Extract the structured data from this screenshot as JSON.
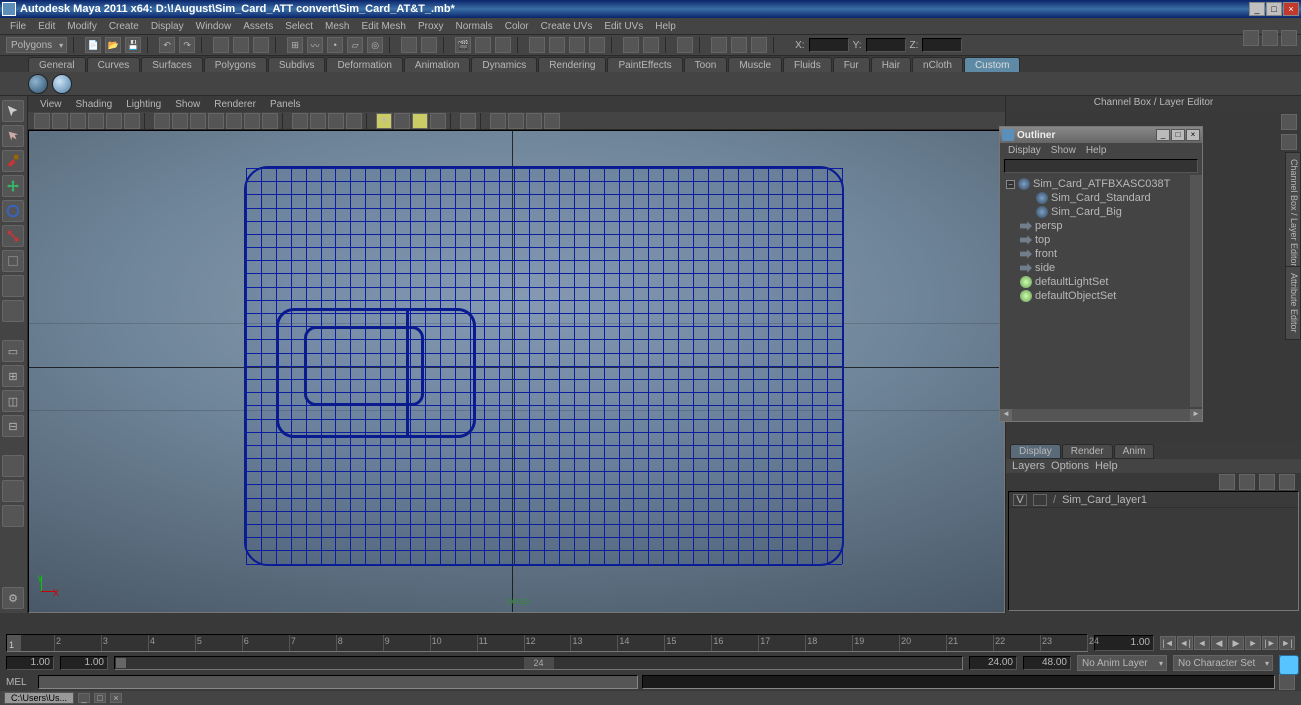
{
  "window": {
    "title": "Autodesk Maya 2011 x64: D:\\!August\\Sim_Card_ATT convert\\Sim_Card_AT&T_.mb*",
    "min": "_",
    "max": "□",
    "close": "×"
  },
  "menus": [
    "File",
    "Edit",
    "Modify",
    "Create",
    "Display",
    "Window",
    "Assets",
    "Select",
    "Mesh",
    "Edit Mesh",
    "Proxy",
    "Normals",
    "Color",
    "Create UVs",
    "Edit UVs",
    "Help"
  ],
  "module_dropdown": "Polygons",
  "coord": {
    "x": "X:",
    "y": "Y:",
    "z": "Z:"
  },
  "shelves": [
    "General",
    "Curves",
    "Surfaces",
    "Polygons",
    "Subdivs",
    "Deformation",
    "Animation",
    "Dynamics",
    "Rendering",
    "PaintEffects",
    "Toon",
    "Muscle",
    "Fluids",
    "Fur",
    "Hair",
    "nCloth",
    "Custom"
  ],
  "active_shelf": "Custom",
  "panel_menus": [
    "View",
    "Shading",
    "Lighting",
    "Show",
    "Renderer",
    "Panels"
  ],
  "viewport": {
    "camera": "persp",
    "axis_y": "Y",
    "axis_x": "X"
  },
  "channelbox_title": "Channel Box / Layer Editor",
  "outliner": {
    "title": "Outliner",
    "menus": [
      "Display",
      "Show",
      "Help"
    ],
    "items": [
      {
        "name": "Sim_Card_ATFBXASC038T",
        "type": "mesh",
        "indent": 0,
        "expanded": true
      },
      {
        "name": "Sim_Card_Standard",
        "type": "mesh",
        "indent": 1
      },
      {
        "name": "Sim_Card_Big",
        "type": "mesh",
        "indent": 1
      },
      {
        "name": "persp",
        "type": "cam",
        "indent": 0,
        "dim": true
      },
      {
        "name": "top",
        "type": "cam",
        "indent": 0,
        "dim": true
      },
      {
        "name": "front",
        "type": "cam",
        "indent": 0,
        "dim": true
      },
      {
        "name": "side",
        "type": "cam",
        "indent": 0,
        "dim": true
      },
      {
        "name": "defaultLightSet",
        "type": "set",
        "indent": 0
      },
      {
        "name": "defaultObjectSet",
        "type": "set",
        "indent": 0
      }
    ]
  },
  "layers_tabs": [
    "Display",
    "Render",
    "Anim"
  ],
  "active_layer_tab": "Display",
  "layers_menu": [
    "Layers",
    "Options",
    "Help"
  ],
  "layer_row": {
    "vis": "V",
    "type": "",
    "name": "Sim_Card_layer1"
  },
  "time": {
    "ticks": [
      1,
      2,
      3,
      4,
      5,
      6,
      7,
      8,
      9,
      10,
      11,
      12,
      13,
      14,
      15,
      16,
      17,
      18,
      19,
      20,
      21,
      22,
      23,
      24
    ],
    "current": "1.00"
  },
  "range": {
    "start": "1.00",
    "startInner": "1.00",
    "startRange": "1",
    "cur": "24",
    "end": "24.00",
    "endOuter": "48.00"
  },
  "anim_layer": "No Anim Layer",
  "char_set": "No Character Set",
  "cmd_label": "MEL",
  "task_button": "C:\\Users\\Us...",
  "side_tabs": {
    "channel": "Channel Box / Layer Editor",
    "attr": "Attribute Editor"
  }
}
